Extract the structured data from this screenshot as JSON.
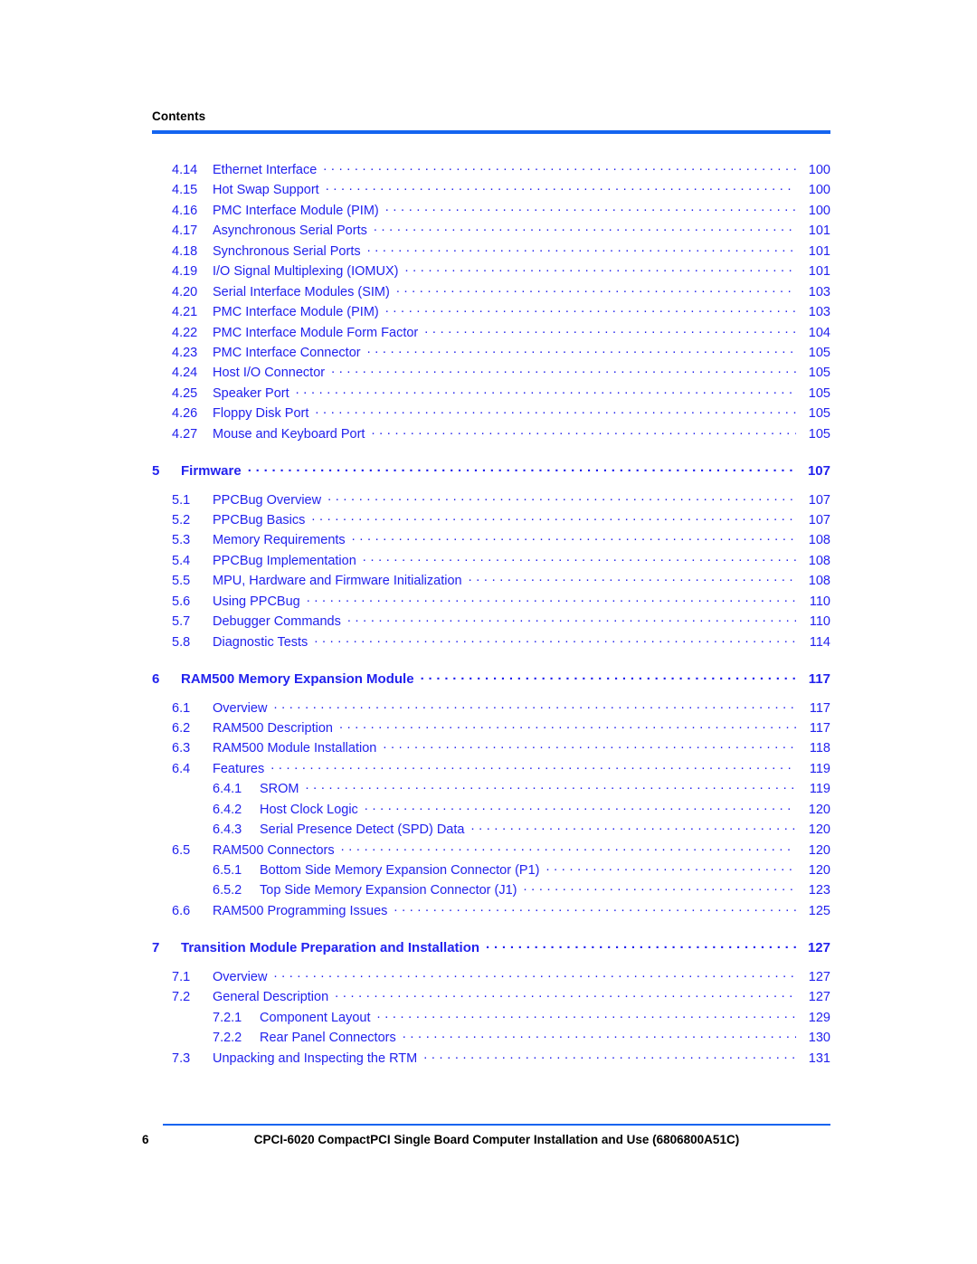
{
  "header": {
    "label": "Contents"
  },
  "footer": {
    "page_number": "6",
    "document_title": "CPCI-6020 CompactPCI Single Board Computer Installation and Use (6806800A51C)"
  },
  "colors": {
    "link_blue": "#2222ee",
    "rule_blue": "#1464f0",
    "text_black": "#000000"
  },
  "toc": {
    "entries": [
      {
        "number": "4.14",
        "title": "Ethernet Interface",
        "page": "100",
        "level": 1,
        "spacing": "none"
      },
      {
        "number": "4.15",
        "title": "Hot Swap Support",
        "page": "100",
        "level": 1,
        "spacing": "none"
      },
      {
        "number": "4.16",
        "title": "PMC Interface Module (PIM)",
        "page": "100",
        "level": 1,
        "spacing": "none"
      },
      {
        "number": "4.17",
        "title": "Asynchronous Serial Ports",
        "page": "101",
        "level": 1,
        "spacing": "none"
      },
      {
        "number": "4.18",
        "title": "Synchronous Serial Ports",
        "page": "101",
        "level": 1,
        "spacing": "none"
      },
      {
        "number": "4.19",
        "title": "I/O Signal Multiplexing (IOMUX)",
        "page": "101",
        "level": 1,
        "spacing": "none"
      },
      {
        "number": "4.20",
        "title": "Serial Interface Modules (SIM)",
        "page": "103",
        "level": 1,
        "spacing": "none"
      },
      {
        "number": "4.21",
        "title": "PMC Interface Module (PIM)",
        "page": "103",
        "level": 1,
        "spacing": "none"
      },
      {
        "number": "4.22",
        "title": "PMC Interface Module Form Factor",
        "page": "104",
        "level": 1,
        "spacing": "none"
      },
      {
        "number": "4.23",
        "title": "PMC Interface Connector",
        "page": "105",
        "level": 1,
        "spacing": "none"
      },
      {
        "number": "4.24",
        "title": "Host I/O Connector",
        "page": "105",
        "level": 1,
        "spacing": "none"
      },
      {
        "number": "4.25",
        "title": "Speaker Port",
        "page": "105",
        "level": 1,
        "spacing": "none"
      },
      {
        "number": "4.26",
        "title": "Floppy Disk Port",
        "page": "105",
        "level": 1,
        "spacing": "none"
      },
      {
        "number": "4.27",
        "title": "Mouse and Keyboard Port",
        "page": "105",
        "level": 1,
        "spacing": "none"
      },
      {
        "number": "5",
        "title": "Firmware",
        "page": "107",
        "level": 0,
        "spacing": "chapter"
      },
      {
        "number": "5.1",
        "title": "PPCBug Overview",
        "page": "107",
        "level": 1,
        "spacing": "after-chapter"
      },
      {
        "number": "5.2",
        "title": "PPCBug Basics",
        "page": "107",
        "level": 1,
        "spacing": "none"
      },
      {
        "number": "5.3",
        "title": "Memory Requirements",
        "page": "108",
        "level": 1,
        "spacing": "none"
      },
      {
        "number": "5.4",
        "title": "PPCBug Implementation",
        "page": "108",
        "level": 1,
        "spacing": "none"
      },
      {
        "number": "5.5",
        "title": "MPU, Hardware and Firmware Initialization",
        "page": "108",
        "level": 1,
        "spacing": "none"
      },
      {
        "number": "5.6",
        "title": "Using PPCBug",
        "page": "110",
        "level": 1,
        "spacing": "none"
      },
      {
        "number": "5.7",
        "title": "Debugger Commands",
        "page": "110",
        "level": 1,
        "spacing": "none"
      },
      {
        "number": "5.8",
        "title": "Diagnostic Tests",
        "page": "114",
        "level": 1,
        "spacing": "none"
      },
      {
        "number": "6",
        "title": "RAM500 Memory Expansion Module",
        "page": "117",
        "level": 0,
        "spacing": "chapter"
      },
      {
        "number": "6.1",
        "title": "Overview",
        "page": "117",
        "level": 1,
        "spacing": "after-chapter"
      },
      {
        "number": "6.2",
        "title": "RAM500 Description",
        "page": "117",
        "level": 1,
        "spacing": "none"
      },
      {
        "number": "6.3",
        "title": "RAM500 Module Installation",
        "page": "118",
        "level": 1,
        "spacing": "none"
      },
      {
        "number": "6.4",
        "title": "Features",
        "page": "119",
        "level": 1,
        "spacing": "none"
      },
      {
        "number": "6.4.1",
        "title": "SROM",
        "page": "119",
        "level": 2,
        "spacing": "none"
      },
      {
        "number": "6.4.2",
        "title": "Host Clock Logic",
        "page": "120",
        "level": 2,
        "spacing": "none"
      },
      {
        "number": "6.4.3",
        "title": "Serial Presence Detect (SPD) Data",
        "page": "120",
        "level": 2,
        "spacing": "none"
      },
      {
        "number": "6.5",
        "title": "RAM500 Connectors",
        "page": "120",
        "level": 1,
        "spacing": "none"
      },
      {
        "number": "6.5.1",
        "title": "Bottom Side Memory Expansion Connector (P1)",
        "page": "120",
        "level": 2,
        "spacing": "none"
      },
      {
        "number": "6.5.2",
        "title": "Top Side Memory Expansion Connector (J1)",
        "page": "123",
        "level": 2,
        "spacing": "none"
      },
      {
        "number": "6.6",
        "title": "RAM500 Programming Issues",
        "page": "125",
        "level": 1,
        "spacing": "none"
      },
      {
        "number": "7",
        "title": "Transition Module Preparation and Installation",
        "page": "127",
        "level": 0,
        "spacing": "chapter"
      },
      {
        "number": "7.1",
        "title": "Overview",
        "page": "127",
        "level": 1,
        "spacing": "after-chapter"
      },
      {
        "number": "7.2",
        "title": "General Description",
        "page": "127",
        "level": 1,
        "spacing": "none"
      },
      {
        "number": "7.2.1",
        "title": "Component Layout",
        "page": "129",
        "level": 2,
        "spacing": "none"
      },
      {
        "number": "7.2.2",
        "title": "Rear Panel Connectors",
        "page": "130",
        "level": 2,
        "spacing": "none"
      },
      {
        "number": "7.3",
        "title": "Unpacking and Inspecting the RTM",
        "page": "131",
        "level": 1,
        "spacing": "none"
      }
    ]
  }
}
